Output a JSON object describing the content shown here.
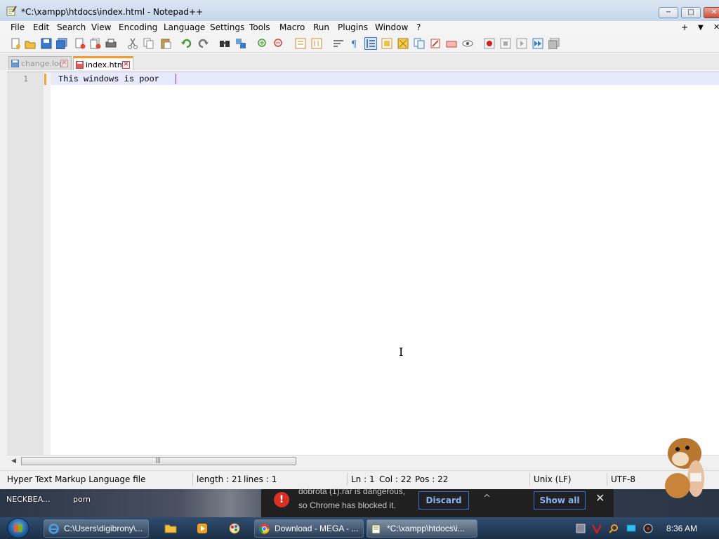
{
  "window": {
    "title": "*C:\\xampp\\htdocs\\index.html - Notepad++",
    "controls": {
      "minimize": "−",
      "maximize": "□",
      "close": "✕"
    }
  },
  "menu": [
    "File",
    "Edit",
    "Search",
    "View",
    "Encoding",
    "Language",
    "Settings",
    "Tools",
    "Macro",
    "Run",
    "Plugins",
    "Window",
    "?"
  ],
  "menu_right": {
    "add": "+",
    "dropdown": "▼",
    "close": "✕"
  },
  "tabs": [
    {
      "label": "change.log",
      "active": false
    },
    {
      "label": "index.html",
      "active": true
    }
  ],
  "tab_close_glyph": "✕",
  "editor": {
    "line_number": "1",
    "text": "This windows is poor "
  },
  "statusbar": {
    "file_type": "Hyper Text Markup Language file",
    "length": "length : 21",
    "lines": "lines : 1",
    "ln": "Ln : 1",
    "col": "Col : 22",
    "pos": "Pos : 22",
    "eol": "Unix (LF)",
    "encoding": "UTF-8"
  },
  "desktop_labels": {
    "left": "NECKBEA...",
    "right": "porn"
  },
  "download_bar": {
    "line1": "dobrota (1).rar is dangerous,",
    "line2": "so Chrome has blocked it.",
    "discard": "Discard",
    "chevron": "^",
    "show_all": "Show all",
    "close": "✕"
  },
  "taskbar": {
    "buttons": [
      {
        "label": "C:\\Users\\digibrony\\..."
      },
      {
        "label": "Download - MEGA - ..."
      },
      {
        "label": "*C:\\xampp\\htdocs\\i..."
      }
    ],
    "clock": "8:36 AM"
  },
  "colors": {
    "accent_orange": "#f79a2b",
    "current_line": "#e8e8ff",
    "caret": "#8a2be2",
    "taskbar": "#1b2f47"
  }
}
